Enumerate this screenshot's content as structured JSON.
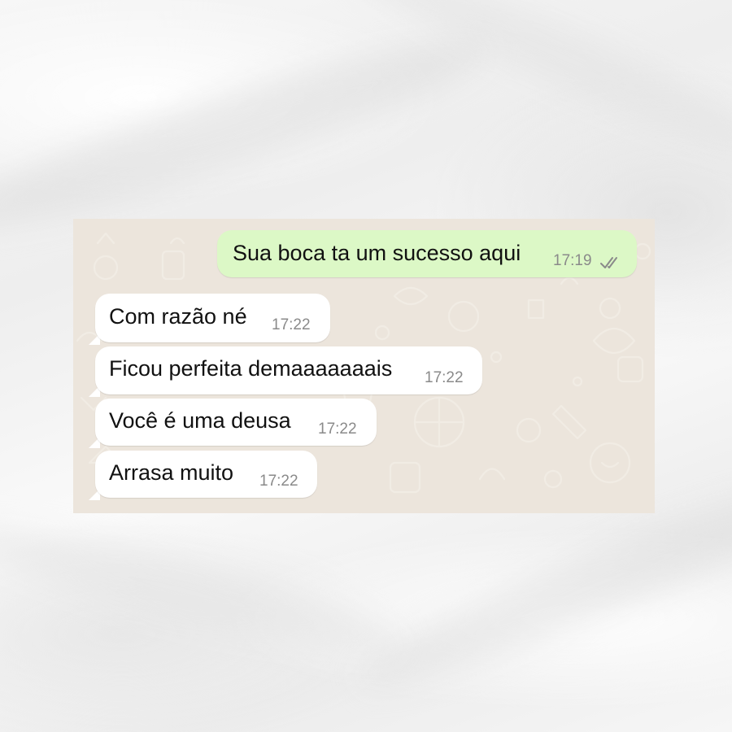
{
  "colors": {
    "outgoing_bubble": "#dcf8c6",
    "incoming_bubble": "#ffffff",
    "wallpaper": "#ece5dc",
    "timestamp": "#8a8a8a",
    "read_ticks": "#8a8a8a"
  },
  "messages": [
    {
      "direction": "outgoing",
      "text": "Sua boca ta um sucesso aqui",
      "time": "17:19",
      "status_icon": "double-check-icon"
    },
    {
      "direction": "incoming",
      "text": "Com razão né",
      "time": "17:22"
    },
    {
      "direction": "incoming",
      "text": "Ficou perfeita demaaaaaaais",
      "time": "17:22"
    },
    {
      "direction": "incoming",
      "text": "Você é uma deusa",
      "time": "17:22"
    },
    {
      "direction": "incoming",
      "text": "Arrasa muito",
      "time": "17:22"
    }
  ]
}
